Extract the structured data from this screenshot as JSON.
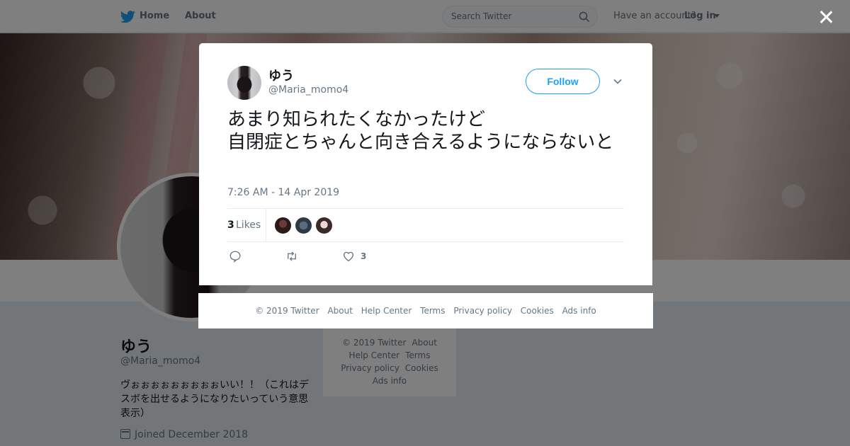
{
  "topbar": {
    "home": "Home",
    "about": "About",
    "search_placeholder": "Search Twitter",
    "account_text": "Have an account?",
    "login": "Log in"
  },
  "profile": {
    "name": "ゆう",
    "handle": "@Maria_momo4",
    "bio": "ヴぉぉぉぉぉぉぉぉぉいい！！（これはデスボを出せるようになりたいっていう意思表示）",
    "joined": "Joined December 2018"
  },
  "side_footer": {
    "items": [
      "© 2019 Twitter",
      "About",
      "Help Center",
      "Terms",
      "Privacy policy",
      "Cookies",
      "Ads info"
    ]
  },
  "tweet": {
    "author_name": "ゆう",
    "author_handle": "@Maria_momo4",
    "follow_label": "Follow",
    "text": "あまり知られたくなかったけど\n自閉症とちゃんと向き合えるようにならないと",
    "timestamp": "7:26 AM - 14 Apr 2019",
    "likes_count": "3",
    "likes_label": "Likes",
    "like_action_count": "3"
  },
  "modal_footer": {
    "items": [
      "© 2019 Twitter",
      "About",
      "Help Center",
      "Terms",
      "Privacy policy",
      "Cookies",
      "Ads info"
    ]
  },
  "colors": {
    "twitter_blue": "#1da1f2",
    "muted_text": "#657786",
    "overlay": "rgba(0,0,0,0.5)"
  },
  "icons": [
    "twitter-bird-icon",
    "search-icon",
    "close-icon",
    "chevron-down-icon",
    "reply-icon",
    "retweet-icon",
    "heart-icon",
    "calendar-icon"
  ]
}
